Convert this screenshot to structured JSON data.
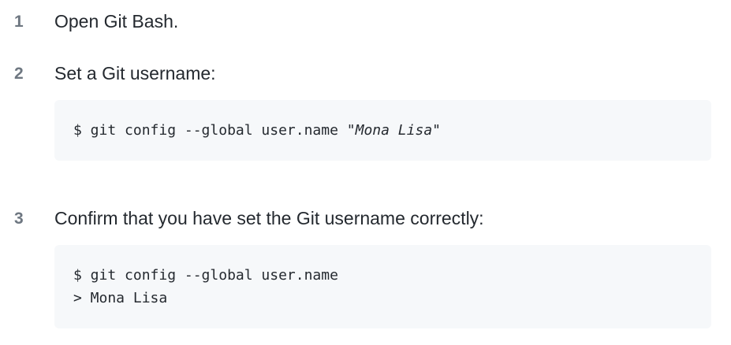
{
  "steps": [
    {
      "number": "1",
      "text": "Open Git Bash."
    },
    {
      "number": "2",
      "text": "Set a Git username:",
      "code": {
        "command": "$ git config --global user.name ",
        "quote_open": "\"",
        "argument": "Mona Lisa",
        "quote_close": "\""
      }
    },
    {
      "number": "3",
      "text": "Confirm that you have set the Git username correctly:",
      "code": {
        "command": "$ git config --global user.name",
        "output": "> Mona Lisa"
      }
    }
  ]
}
